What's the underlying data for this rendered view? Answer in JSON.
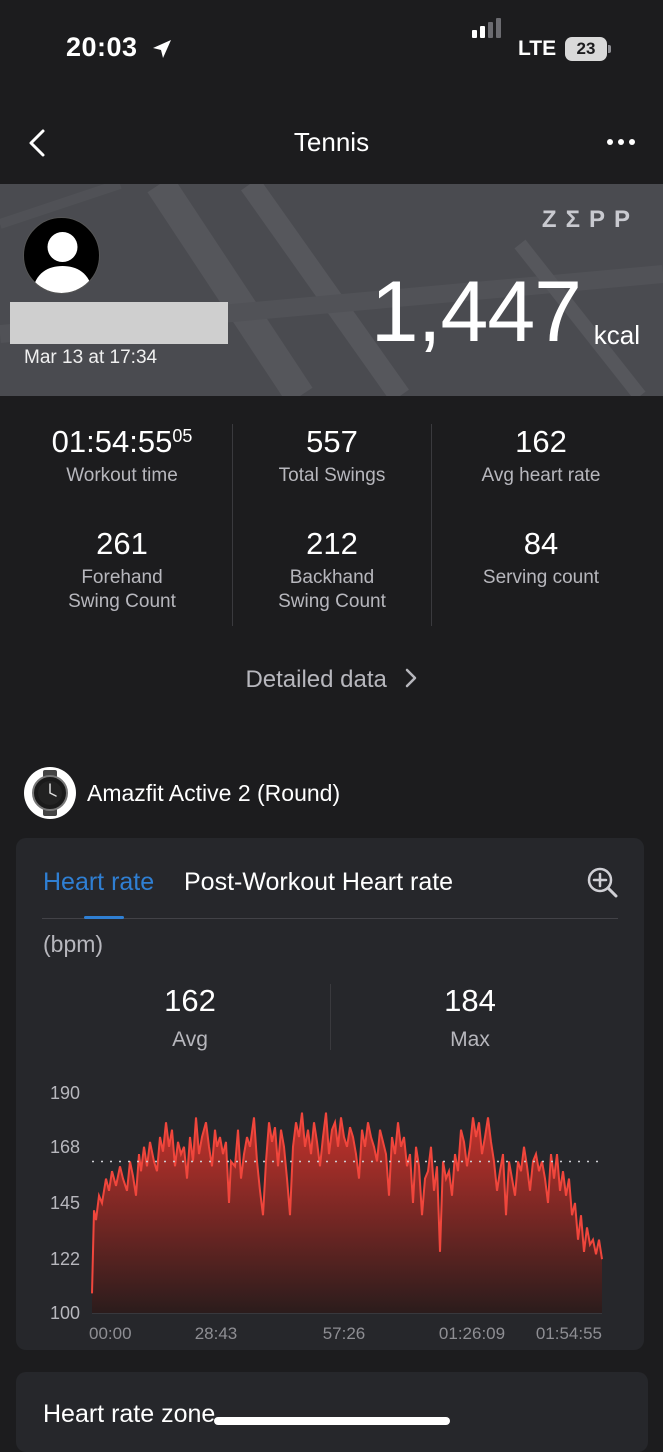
{
  "status_bar": {
    "time": "20:03",
    "network": "LTE",
    "battery": "23"
  },
  "nav": {
    "title": "Tennis"
  },
  "hero": {
    "brand": "ZΣPP",
    "date": "Mar 13 at 17:34",
    "calories": "1,447",
    "calories_unit": "kcal"
  },
  "stats": [
    {
      "value": "01:54:55",
      "value_sup": "05",
      "label": "Workout time"
    },
    {
      "value": "557",
      "label": "Total Swings"
    },
    {
      "value": "162",
      "label": "Avg heart rate"
    },
    {
      "value": "261",
      "label": "Forehand\nSwing Count"
    },
    {
      "value": "212",
      "label": "Backhand\nSwing Count"
    },
    {
      "value": "84",
      "label": "Serving count"
    }
  ],
  "detailed_link": "Detailed data",
  "device": {
    "name": "Amazfit Active 2 (Round)"
  },
  "heart_card": {
    "tabs": [
      "Heart rate",
      "Post-Workout Heart rate"
    ],
    "active_tab": 0,
    "unit": "(bpm)",
    "avg_value": "162",
    "avg_label": "Avg",
    "max_value": "184",
    "max_label": "Max"
  },
  "chart_data": {
    "type": "area",
    "title": "",
    "xlabel": "",
    "ylabel": "(bpm)",
    "ylim": [
      100,
      190
    ],
    "y_ticks": [
      "190",
      "168",
      "145",
      "122",
      "100"
    ],
    "x_ticks": [
      "00:00",
      "28:43",
      "57:26",
      "01:26:09",
      "01:54:55"
    ],
    "reference_line": 162,
    "series": [
      {
        "x": [
          0,
          2,
          4,
          7,
          10,
          14,
          17,
          20,
          24,
          28,
          31,
          35,
          38,
          41,
          44,
          47,
          49,
          52,
          55,
          58,
          62,
          65,
          68,
          71,
          74,
          77,
          80,
          83,
          86,
          89,
          92,
          95,
          98,
          101,
          104,
          107,
          110,
          114,
          117,
          120,
          123,
          125,
          128,
          131,
          134,
          137,
          139,
          143,
          146,
          149,
          152,
          155,
          158,
          162,
          165,
          168,
          171,
          174,
          177,
          180,
          183,
          186,
          189,
          192,
          195,
          198,
          201,
          204,
          207,
          210,
          213,
          216,
          219,
          222,
          225,
          228,
          231,
          234,
          237,
          240,
          243,
          246,
          249,
          252,
          255,
          258,
          261,
          264,
          267,
          270,
          273,
          276,
          279,
          282,
          285,
          288,
          291,
          294,
          297,
          300,
          303,
          306,
          309,
          312,
          315,
          318,
          321,
          324,
          327,
          330,
          333,
          336,
          339,
          342,
          345,
          348,
          351,
          354,
          357,
          360,
          363,
          366,
          369,
          372,
          375,
          378,
          381,
          384,
          387,
          390,
          393,
          396,
          399,
          402,
          405,
          408,
          411,
          414,
          417,
          420,
          423,
          426,
          429,
          432,
          435,
          438,
          441,
          444,
          447,
          450,
          453,
          456,
          459,
          462,
          465,
          468,
          471,
          474,
          477,
          480,
          483,
          486,
          489,
          492,
          495,
          498,
          501,
          504,
          507,
          510
        ],
        "values": [
          108,
          142,
          138,
          148,
          145,
          155,
          150,
          158,
          152,
          160,
          155,
          150,
          162,
          156,
          148,
          165,
          158,
          168,
          160,
          170,
          162,
          158,
          172,
          166,
          178,
          168,
          175,
          160,
          170,
          165,
          168,
          155,
          172,
          162,
          180,
          165,
          172,
          178,
          168,
          160,
          175,
          168,
          172,
          165,
          170,
          145,
          162,
          160,
          175,
          155,
          165,
          172,
          168,
          180,
          162,
          150,
          140,
          162,
          178,
          170,
          176,
          160,
          175,
          168,
          155,
          140,
          168,
          178,
          172,
          182,
          168,
          175,
          165,
          178,
          170,
          160,
          172,
          182,
          165,
          175,
          178,
          168,
          180,
          172,
          168,
          176,
          172,
          165,
          155,
          175,
          168,
          178,
          172,
          168,
          162,
          175,
          170,
          165,
          148,
          172,
          165,
          178,
          168,
          172,
          160,
          165,
          145,
          168,
          160,
          140,
          155,
          158,
          168,
          150,
          160,
          125,
          162,
          155,
          158,
          148,
          165,
          158,
          175,
          170,
          160,
          168,
          180,
          172,
          178,
          165,
          172,
          180,
          170,
          162,
          150,
          158,
          165,
          140,
          162,
          155,
          148,
          162,
          158,
          168,
          160,
          150,
          162,
          165,
          158,
          162,
          155,
          145,
          165,
          155,
          165,
          150,
          158,
          148,
          155,
          140,
          145,
          130,
          140,
          125,
          135,
          128,
          130,
          124,
          130,
          122
        ]
      }
    ]
  },
  "zone_card": {
    "title": "Heart rate zone"
  }
}
